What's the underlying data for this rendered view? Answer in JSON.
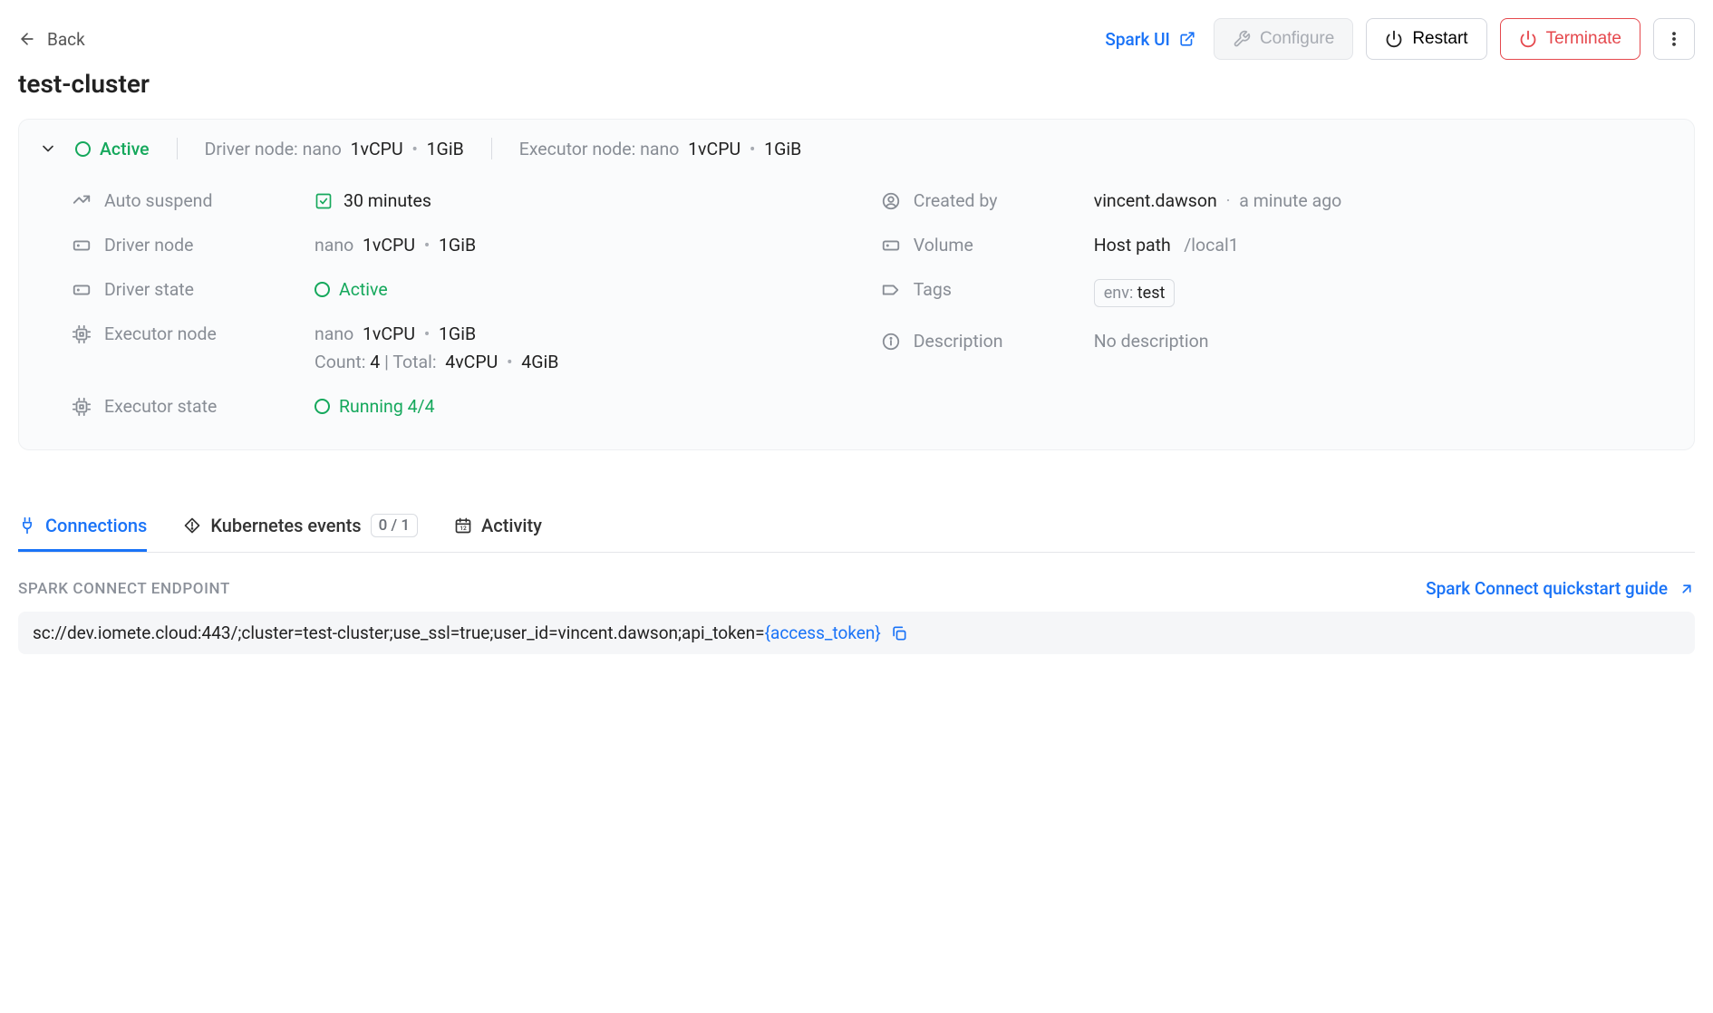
{
  "header": {
    "back_label": "Back",
    "spark_ui_label": "Spark UI",
    "configure_label": "Configure",
    "restart_label": "Restart",
    "terminate_label": "Terminate"
  },
  "page_title": "test-cluster",
  "summary": {
    "status_label": "Active",
    "driver_label_prefix": "Driver node: ",
    "driver_type": "nano",
    "driver_cpu": "1vCPU",
    "driver_mem": "1GiB",
    "executor_label_prefix": "Executor node: ",
    "executor_type": "nano",
    "executor_cpu": "1vCPU",
    "executor_mem": "1GiB"
  },
  "details": {
    "left": {
      "auto_suspend_label": "Auto suspend",
      "auto_suspend_value": "30 minutes",
      "driver_node_label": "Driver node",
      "driver_node_type": "nano",
      "driver_node_cpu": "1vCPU",
      "driver_node_mem": "1GiB",
      "driver_state_label": "Driver state",
      "driver_state_value": "Active",
      "executor_node_label": "Executor node",
      "executor_node_type": "nano",
      "executor_node_cpu": "1vCPU",
      "executor_node_mem": "1GiB",
      "executor_count_label": "Count: ",
      "executor_count_value": "4",
      "executor_count_sep": "  |  ",
      "executor_total_label": "Total:",
      "executor_total_cpu": "4vCPU",
      "executor_total_mem": "4GiB",
      "executor_state_label": "Executor state",
      "executor_state_value": "Running 4/4"
    },
    "right": {
      "created_by_label": "Created by",
      "created_by_user": "vincent.dawson",
      "created_by_time": "a minute ago",
      "volume_label": "Volume",
      "volume_type": "Host path",
      "volume_path": "/local1",
      "tags_label": "Tags",
      "tag_key": "env",
      "tag_value": "test",
      "description_label": "Description",
      "description_value": "No description"
    }
  },
  "tabs": {
    "connections_label": "Connections",
    "kubernetes_events_label": "Kubernetes events",
    "kubernetes_events_count": "0 / 1",
    "activity_label": "Activity"
  },
  "endpoint": {
    "section_title": "SPARK CONNECT ENDPOINT",
    "guide_link_label": "Spark Connect quickstart guide",
    "value_prefix": "sc://dev.iomete.cloud:443/;cluster=test-cluster;use_ssl=true;user_id=vincent.dawson;api_token=",
    "value_token": "{access_token}"
  }
}
